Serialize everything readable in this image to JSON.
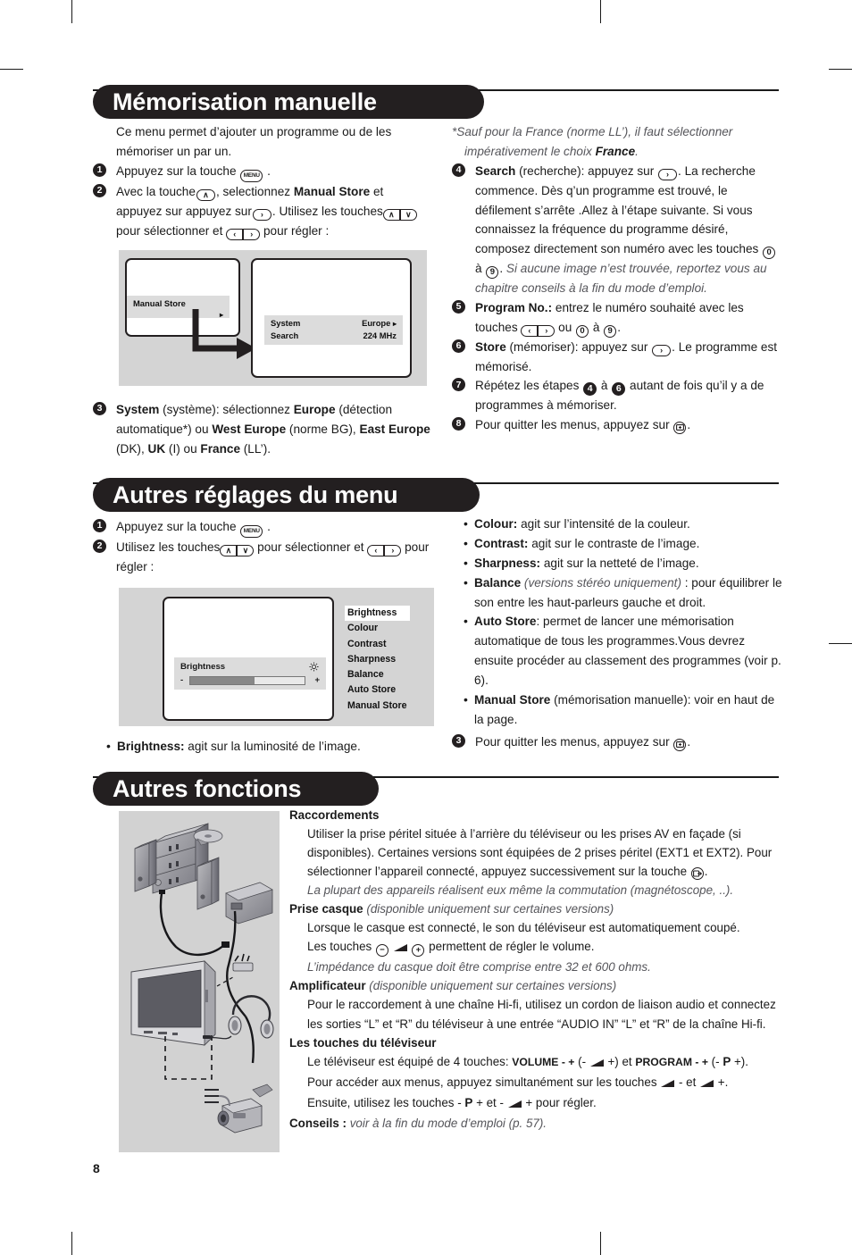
{
  "page": {
    "number": "8"
  },
  "sections": [
    {
      "id": "memorisation-manuelle",
      "title": "Mémorisation manuelle",
      "intro": "Ce menu permet d’ajouter un programme ou de les mémoriser un par un.",
      "left_steps": [
        {
          "n": "1",
          "text_a": "Appuyez sur la touche",
          "key": "MENU",
          "text_b": "."
        },
        {
          "n": "2",
          "text_a": "Avec la touche",
          "text_b": ", selectionnez",
          "bold": "Manual Store",
          "text_c": "et appuyez sur",
          "text_d": ". Utilisez les touches",
          "text_e": "pour sélectionner et",
          "text_f": "pour régler :"
        },
        {
          "n": "3",
          "bold": "System",
          "paren": "(système)",
          "text": ": sélectionnez Europe (détection automatique*) ou West Europe (norme BG), East Europe (DK), UK (I) ou France (LL’)."
        }
      ],
      "step3_parts": {
        "b1": "System",
        "p1": " (système): sélectionnez ",
        "b2": "Europe",
        "p2": " (détection automatique*) ou ",
        "b3": "West Europe",
        "p3": " (norme BG), ",
        "b4": "East Europe",
        "p4": " (DK), ",
        "b5": "UK",
        "p5": " (I) ou ",
        "b6": "France",
        "p6": " (LL’)."
      },
      "footnote": {
        "star": "*",
        "text_a": "Sauf pour la France (norme LL’), il faut sélectionner impérativement le choix ",
        "bold": "France",
        "text_b": "."
      },
      "right_steps": [
        {
          "n": "4",
          "bold": "Search",
          "lead": " (recherche): appuyez sur ",
          "after": ".",
          "body": "La recherche commence. Dès q’un programme est trouvé, le défilement s’arrête .Allez à l’étape suivante. Si vous connaissez la fréquence du programme désiré, composez directement son numéro avec les touches ",
          "body_tail": " à ",
          "body_end": ".",
          "note": "Si aucune image n’est trouvée, reportez vous au chapitre conseils à la fin du mode d’emploi."
        },
        {
          "n": "5",
          "bold": "Program No.:",
          "lead": " entrez le numéro souhaité avec les touches ",
          "mid": " ou ",
          "tail": " à ",
          "end": "."
        },
        {
          "n": "6",
          "bold": "Store",
          "lead": " (mémoriser): appuyez sur ",
          "after": ".",
          "body": "Le programme est mémorisé."
        },
        {
          "n": "7",
          "lead": "Répétez les étapes ",
          "mid": " à ",
          "tail": " autant de fois qu’il y a de programmes à mémoriser."
        },
        {
          "n": "8",
          "lead": "Pour quitter les menus, appuyez sur ",
          "after": "."
        }
      ],
      "figure": {
        "screen1": {
          "item": "Manual Store",
          "caret": "▸"
        },
        "screen2": {
          "rows": [
            {
              "label": "System",
              "value": "Europe",
              "caret": "▸"
            },
            {
              "label": "Search",
              "value": "224 MHz",
              "caret": ""
            }
          ]
        }
      }
    },
    {
      "id": "autres-reglages-du-menu",
      "title": "Autres réglages du menu",
      "left_steps": [
        {
          "n": "1",
          "text_a": "Appuyez sur la touche",
          "key": "MENU",
          "text_b": "."
        },
        {
          "n": "2",
          "text_a": "Utilisez les touches",
          "text_b": "pour sélectionner et",
          "text_c": "pour régler :"
        }
      ],
      "figure": {
        "slider": {
          "title": "Brightness",
          "minus": "-",
          "plus": "+",
          "fill_percent": 56
        },
        "menu_items": [
          "Brightness",
          "Colour",
          "Contrast",
          "Sharpness",
          "Balance",
          "Auto Store",
          "Manual Store"
        ],
        "selected_item": "Brightness"
      },
      "left_bullet": {
        "bold": "Brightness:",
        "text": " agit sur la luminosité de l’image."
      },
      "right_bullets": [
        {
          "bold": "Colour:",
          "text": " agit sur l’intensité de la couleur."
        },
        {
          "bold": "Contrast:",
          "text": " agit sur le contraste de l’image."
        },
        {
          "bold": "Sharpness:",
          "text": " agit sur la netteté de l’image."
        },
        {
          "bold": "Balance",
          "italic": " (versions stéréo uniquement)",
          "text": " : pour équilibrer le son entre les haut-parleurs gauche et droit.",
          "text_bold_tail": true
        },
        {
          "bold": "Auto Store",
          "text": ": permet de lancer une mémorisation automatique de tous les programmes.Vous devrez ensuite procéder au classement des programmes (voir p. 6)."
        },
        {
          "bold": "Manual Store",
          "text": " (mémorisation manuelle): voir en haut de la page."
        }
      ],
      "right_last_step": {
        "n": "3",
        "lead": "Pour quitter les menus, appuyez sur ",
        "after": "."
      }
    },
    {
      "id": "autres-fonctions",
      "title": "Autres fonctions",
      "blocks": [
        {
          "heading": "Raccordements",
          "body": "Utiliser la prise péritel située à l’arrière du téléviseur ou les prises AV en façade (si disponibles). Certaines versions sont équipées de 2 prises péritel (EXT1 et EXT2). Pour sélectionner l’appareil connecté, appuyez successivement sur la touche ",
          "body_end": ".",
          "note": "La plupart des appareils réalisent eux même la commutation (magnétoscope, ..)."
        },
        {
          "heading": "Prise casque",
          "heading_italic": " (disponible uniquement sur certaines versions)",
          "body_a": "Lorsque le casque est connecté, le son du téléviseur est automatiquement coupé.",
          "body_b_lead": "Les touches ",
          "body_b_tail": " permettent de régler le volume.",
          "note": "L’impédance du casque doit être comprise entre 32 et 600 ohms."
        },
        {
          "heading": "Amplificateur",
          "heading_italic": " (disponible uniquement sur certaines versions)",
          "body": "Pour le raccordement à une chaîne Hi-fi, utilisez un cordon de liaison audio et connectez les sorties “L” et “R” du téléviseur à une entrée “AUDIO IN” “L” et “R” de la chaîne Hi-fi."
        },
        {
          "heading": "Les touches du téléviseur",
          "line1_a": "Le téléviseur est équipé de 4 touches: ",
          "line1_volume": "VOLUME - +",
          "line1_b": " (- ",
          "line1_c": " +) et ",
          "line1_program": "PROGRAM - +",
          "line1_d": " (- ",
          "line1_p": "P",
          "line1_e": " +).",
          "line2_a": "Pour accéder aux menus, appuyez simultanément sur les touches ",
          "line2_b": " - et ",
          "line2_c": " +.",
          "line3_a": "Ensuite, utilisez les touches - ",
          "line3_p": "P",
          "line3_b": " + et - ",
          "line3_c": " + pour régler."
        }
      ],
      "tips": {
        "bold": "Conseils :",
        "italic": " voir à la fin du mode d’emploi (p. 57)."
      }
    }
  ],
  "keys": {
    "menu": "MENU",
    "up": "∧",
    "down": "∨",
    "left": "‹",
    "right": "›",
    "zero": "0",
    "nine": "9",
    "minus": "−",
    "plus": "+"
  },
  "colors": {
    "banner_bg": "#231f20",
    "figure_bg": "#d4d4d4",
    "osd_bg": "#dcdcdc",
    "note_text": "#55555a"
  }
}
